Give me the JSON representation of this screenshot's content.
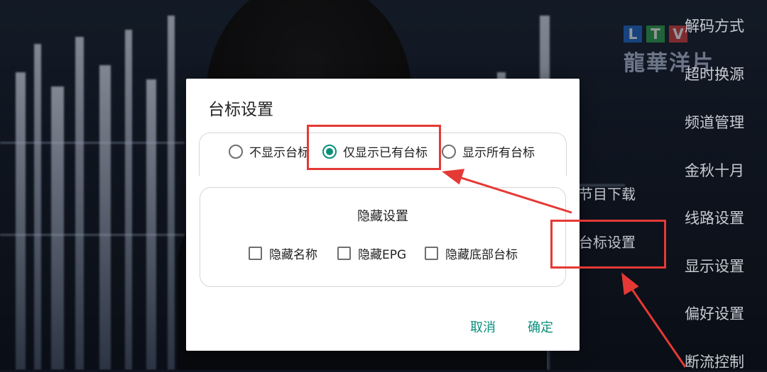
{
  "logo": {
    "letters": [
      "L",
      "T",
      "V"
    ],
    "name": "龍華洋片"
  },
  "side_menu": {
    "items": [
      "解码方式",
      "超时换源",
      "频道管理",
      "金秋十月",
      "线路设置",
      "显示设置",
      "偏好设置",
      "断流控制"
    ]
  },
  "sub_menu": {
    "items": [
      "节目下载",
      "台标设置"
    ]
  },
  "dialog": {
    "title": "台标设置",
    "logo_mode": {
      "options": [
        "不显示台标",
        "仅显示已有台标",
        "显示所有台标"
      ],
      "selected": "仅显示已有台标"
    },
    "hide_settings": {
      "title": "隐藏设置",
      "options": [
        {
          "label": "隐藏名称",
          "checked": false
        },
        {
          "label": "隐藏EPG",
          "checked": false
        },
        {
          "label": "隐藏底部台标",
          "checked": false
        }
      ]
    },
    "cancel_label": "取消",
    "ok_label": "确定"
  },
  "colors": {
    "accent": "#0a8f7b",
    "annotation": "#e53935",
    "dialog_bg": "#ffffff"
  }
}
